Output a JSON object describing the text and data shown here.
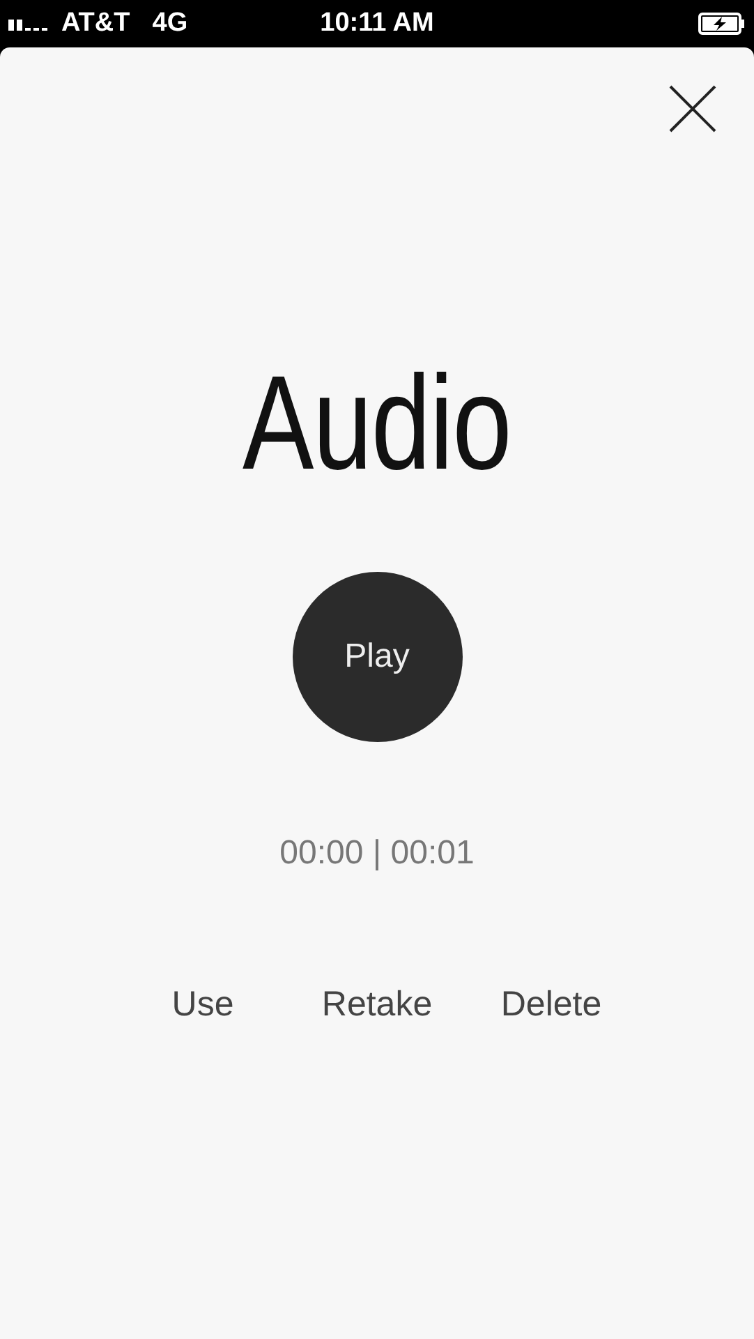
{
  "status_bar": {
    "carrier": "AT&T",
    "network": "4G",
    "time": "10:11 AM"
  },
  "title": "Audio",
  "play_button": {
    "label": "Play"
  },
  "timer": "00:00 | 00:01",
  "actions": [
    {
      "label": "Use"
    },
    {
      "label": "Retake"
    },
    {
      "label": "Delete"
    }
  ]
}
